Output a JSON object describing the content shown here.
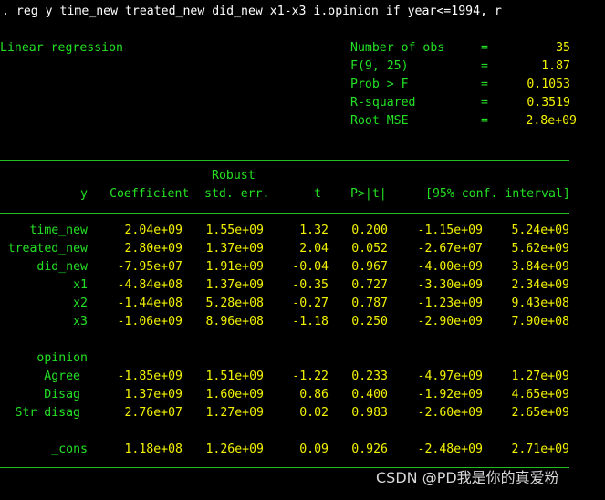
{
  "command": ". reg y time_new treated_new did_new x1-x3 i.opinion if year<=1994, r",
  "title": "Linear regression",
  "stats": [
    {
      "label": "Number of obs",
      "eq": "=",
      "value": "35"
    },
    {
      "label": "F(9, 25)",
      "eq": "=",
      "value": "1.87"
    },
    {
      "label": "Prob > F",
      "eq": "=",
      "value": "0.1053"
    },
    {
      "label": "R-squared",
      "eq": "=",
      "value": "0.3519"
    },
    {
      "label": "Root MSE",
      "eq": "=",
      "value": "2.8e+09"
    }
  ],
  "table": {
    "header_top": "Robust",
    "headers": [
      "y",
      "Coefficient",
      "std. err.",
      "t",
      "P>|t|",
      "[95% conf. interval]"
    ],
    "rows": [
      {
        "label": "time_new",
        "coef": "2.04e+09",
        "se": "1.55e+09",
        "t": "1.32",
        "p": "0.200",
        "lo": "-1.15e+09",
        "hi": "5.24e+09"
      },
      {
        "label": "treated_new",
        "coef": "2.80e+09",
        "se": "1.37e+09",
        "t": "2.04",
        "p": "0.052",
        "lo": "-2.67e+07",
        "hi": "5.62e+09"
      },
      {
        "label": "did_new",
        "coef": "-7.95e+07",
        "se": "1.91e+09",
        "t": "-0.04",
        "p": "0.967",
        "lo": "-4.00e+09",
        "hi": "3.84e+09"
      },
      {
        "label": "x1",
        "coef": "-4.84e+08",
        "se": "1.37e+09",
        "t": "-0.35",
        "p": "0.727",
        "lo": "-3.30e+09",
        "hi": "2.34e+09"
      },
      {
        "label": "x2",
        "coef": "-1.44e+08",
        "se": "5.28e+08",
        "t": "-0.27",
        "p": "0.787",
        "lo": "-1.23e+09",
        "hi": "9.43e+08"
      },
      {
        "label": "x3",
        "coef": "-1.06e+09",
        "se": "8.96e+08",
        "t": "-1.18",
        "p": "0.250",
        "lo": "-2.90e+09",
        "hi": "7.90e+08"
      }
    ],
    "factor": "opinion",
    "factor_rows": [
      {
        "label": "Agree",
        "coef": "-1.85e+09",
        "se": "1.51e+09",
        "t": "-1.22",
        "p": "0.233",
        "lo": "-4.97e+09",
        "hi": "1.27e+09"
      },
      {
        "label": "Disag",
        "coef": "1.37e+09",
        "se": "1.60e+09",
        "t": "0.86",
        "p": "0.400",
        "lo": "-1.92e+09",
        "hi": "4.65e+09"
      },
      {
        "label": "Str disag",
        "coef": "2.76e+07",
        "se": "1.27e+09",
        "t": "0.02",
        "p": "0.983",
        "lo": "-2.60e+09",
        "hi": "2.65e+09"
      }
    ],
    "cons": {
      "label": "_cons",
      "coef": "1.18e+08",
      "se": "1.26e+09",
      "t": "0.09",
      "p": "0.926",
      "lo": "-2.48e+09",
      "hi": "2.71e+09"
    }
  },
  "watermark": "CSDN @PD我是你的真爱粉"
}
